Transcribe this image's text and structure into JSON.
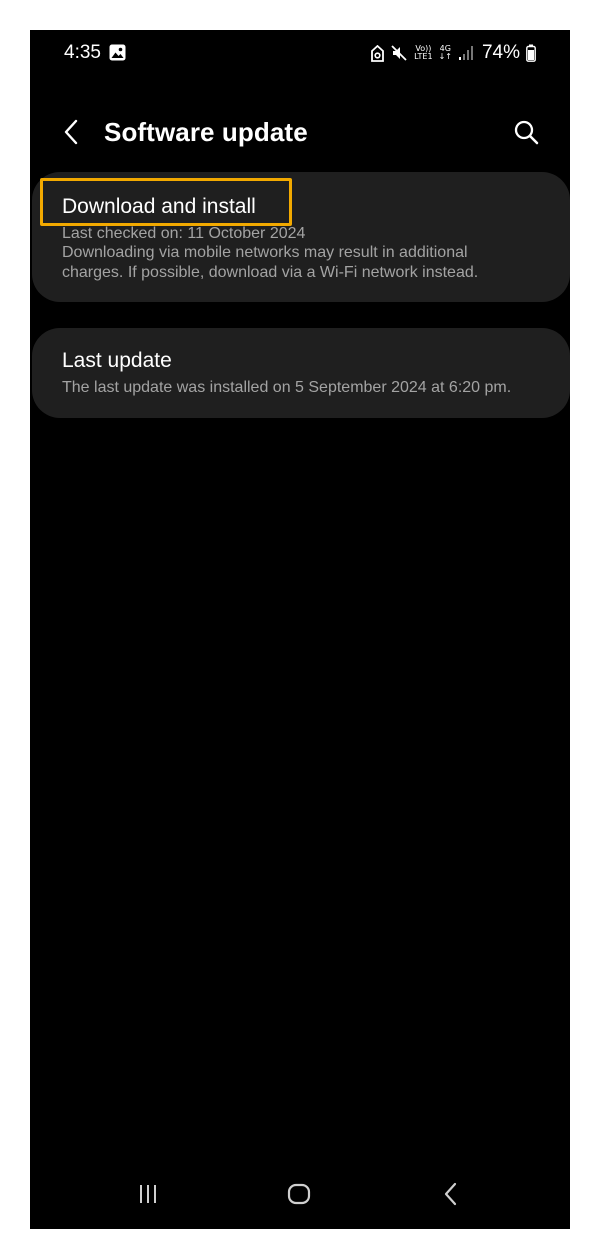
{
  "status_bar": {
    "time": "4:35",
    "battery": "74%",
    "network": "4G",
    "volte_label": "Vo))",
    "lte_label": "LTE1",
    "icons": [
      "gallery-icon",
      "saver-icon",
      "mute-icon",
      "volte-icon",
      "data-arrows-icon",
      "signal-icon",
      "battery-icon"
    ]
  },
  "header": {
    "title": "Software update",
    "back_icon": "chevron-left-icon",
    "search_icon": "search-icon"
  },
  "download_card": {
    "title": "Download and install",
    "last_checked": "Last checked on: 11 October 2024",
    "note_line1": "Downloading via mobile networks may result in additional",
    "note_line2": "charges. If possible, download via a Wi-Fi network instead.",
    "highlight_color": "#f2a900"
  },
  "last_update_card": {
    "title": "Last update",
    "detail": "The last update was installed on 5 September 2024 at 6:20 pm."
  },
  "nav_bar": {
    "icons": [
      "recents-icon",
      "home-icon",
      "back-icon"
    ]
  },
  "colors": {
    "background": "#000000",
    "card": "#1f1f1f",
    "text_primary": "#ffffff",
    "text_secondary": "#a3a3a3",
    "page_frame": "#ffffff"
  }
}
